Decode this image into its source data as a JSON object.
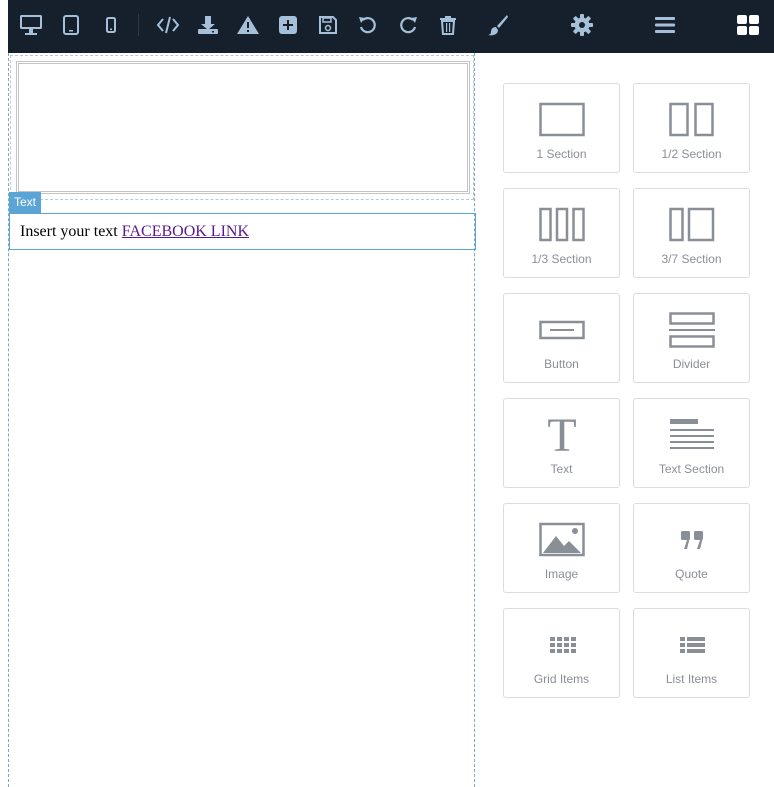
{
  "toolbar": {
    "icons": [
      "desktop-icon",
      "tablet-icon",
      "mobile-icon",
      "code-icon",
      "download-icon",
      "warning-icon",
      "add-icon",
      "save-icon",
      "undo-icon",
      "redo-icon",
      "trash-icon",
      "paint-brush-icon",
      "gear-icon",
      "menu-icon",
      "blocks-grid-icon"
    ],
    "background": "#16202c",
    "icon_color": "#a5c0d8"
  },
  "canvas": {
    "selected_tag": "Text",
    "text_prefix": "Insert your text ",
    "link_text": "FACEBOOK LINK"
  },
  "blocks": {
    "one_section": "1 Section",
    "half_section": "1/2 Section",
    "third_section": "1/3 Section",
    "three_seven_section": "3/7 Section",
    "button": "Button",
    "divider": "Divider",
    "text": "Text",
    "text_section": "Text Section",
    "image": "Image",
    "quote": "Quote",
    "grid_items": "Grid Items",
    "list_items": "List Items"
  },
  "colors": {
    "accent": "#5ba4d6",
    "block_icon": "#8a8f97",
    "link": "#551a8b"
  }
}
